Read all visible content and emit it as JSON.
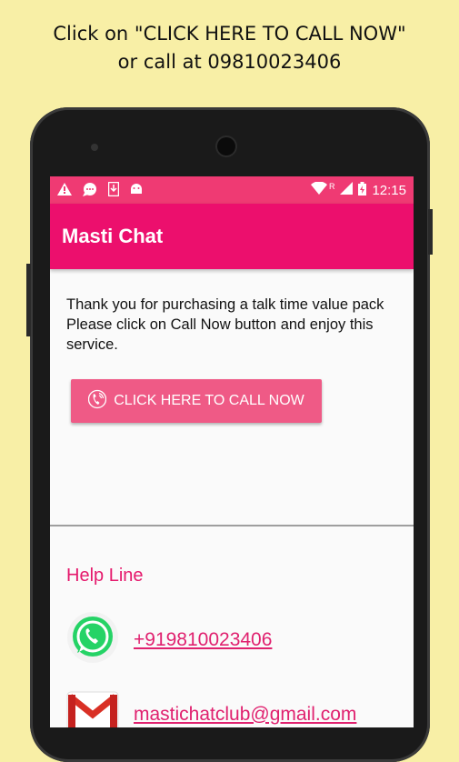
{
  "caption": {
    "line1": "Click on \"CLICK HERE TO CALL NOW\"",
    "line2": "or call at 09810023406"
  },
  "statusbar": {
    "icons_left": [
      "warning-icon",
      "chat-icon",
      "download-icon",
      "android-icon"
    ],
    "icons_right": [
      "wifi-icon",
      "signal-icon",
      "battery-charging-icon"
    ],
    "roaming": "R",
    "time": "12:15"
  },
  "appbar": {
    "title": "Masti Chat"
  },
  "main": {
    "message_line1": "Thank you for purchasing a talk time value pack",
    "message_line2": "Please click on Call Now button and enjoy this",
    "message_line3": "service.",
    "call_button_label": "CLICK HERE TO CALL NOW"
  },
  "helpline": {
    "title": "Help Line",
    "phone": "+919810023406",
    "email": "mastichatclub@gmail.com"
  },
  "colors": {
    "background": "#f8efa6",
    "statusbar": "#ef3a73",
    "appbar": "#ec0f6d",
    "button": "#ef5a86",
    "accent_text": "#e5196c",
    "whatsapp": "#25d366"
  }
}
